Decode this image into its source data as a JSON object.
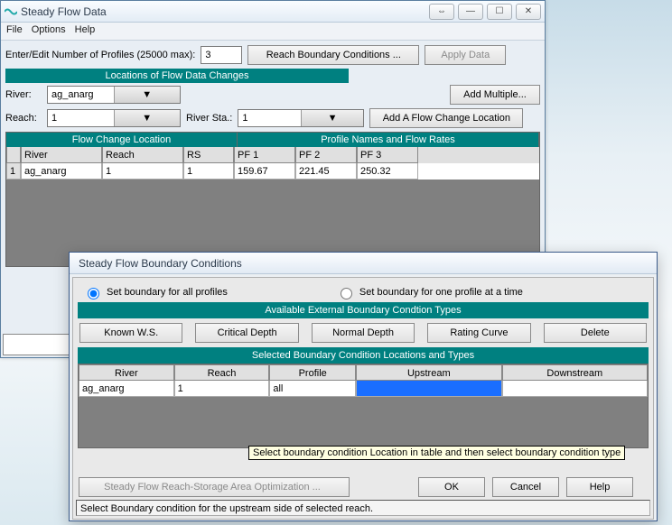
{
  "mainWindow": {
    "title": "Steady Flow Data",
    "menu": {
      "file": "File",
      "options": "Options",
      "help": "Help"
    },
    "profilesLabel": "Enter/Edit Number of Profiles (25000 max):",
    "profilesValue": "3",
    "reachBCButton": "Reach Boundary Conditions ...",
    "applyData": "Apply Data",
    "locationsHeader": "Locations of Flow Data Changes",
    "riverLabel": "River:",
    "riverCombo": "ag_anarg",
    "addMultiple": "Add Multiple...",
    "reachLabel": "Reach:",
    "reachCombo": "1",
    "riverStaLabel": "River Sta.:",
    "riverStaCombo": "1",
    "addFlowChange": "Add A Flow Change Location",
    "gridLeftHeader": "Flow Change Location",
    "gridRightHeader": "Profile Names and Flow Rates",
    "cols": {
      "num": " ",
      "river": "River",
      "reach": "Reach",
      "rs": "RS",
      "pf1": "PF 1",
      "pf2": "PF 2",
      "pf3": "PF 3"
    },
    "row": {
      "num": "1",
      "river": "ag_anarg",
      "reach": "1",
      "rs": "1",
      "pf1": "159.67",
      "pf2": "221.45",
      "pf3": "250.32"
    }
  },
  "dialog": {
    "title": "Steady Flow Boundary Conditions",
    "radioAll": "Set boundary for all profiles",
    "radioOne": "Set boundary for one profile at a time",
    "availHeader": "Available External Boundary Condtion Types",
    "btnKnown": "Known W.S.",
    "btnCritical": "Critical Depth",
    "btnNormal": "Normal Depth",
    "btnRating": "Rating Curve",
    "btnDelete": "Delete",
    "selHeader": "Selected Boundary Condition Locations and Types",
    "cols": {
      "river": "River",
      "reach": "Reach",
      "profile": "Profile",
      "upstream": "Upstream",
      "downstream": "Downstream"
    },
    "row": {
      "river": "ag_anarg",
      "reach": "1",
      "profile": "all",
      "upstream": "",
      "downstream": ""
    },
    "tooltip": "Select boundary condition Location in table and then select boundary condition type",
    "optBtn": "Steady Flow Reach-Storage Area Optimization ...",
    "ok": "OK",
    "cancel": "Cancel",
    "help": "Help",
    "status": "Select Boundary condition for the upstream side of selected reach."
  },
  "chart_data": {
    "type": "table",
    "title": "Profile Names and Flow Rates",
    "categories": [
      "PF 1",
      "PF 2",
      "PF 3"
    ],
    "values": [
      159.67,
      221.45,
      250.32
    ],
    "location": {
      "River": "ag_anarg",
      "Reach": "1",
      "RS": "1"
    }
  }
}
